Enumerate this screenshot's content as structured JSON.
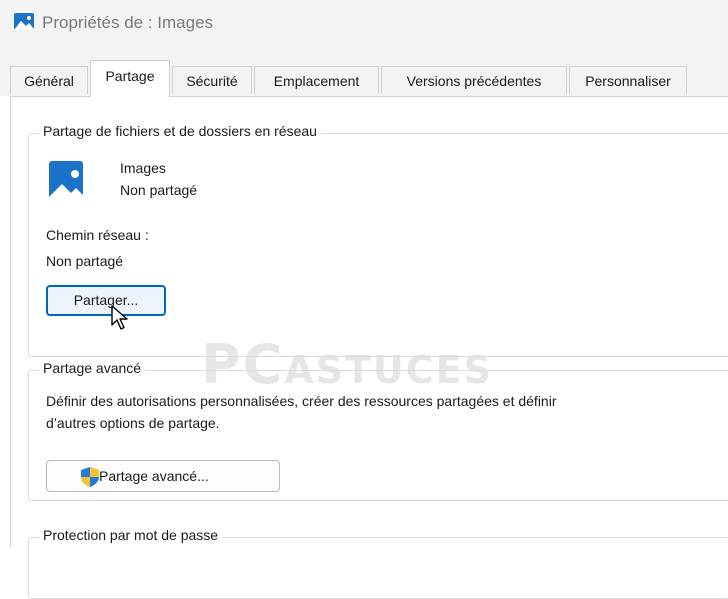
{
  "window": {
    "title": "Propriétés de : Images",
    "icon": "folder-images-icon"
  },
  "tabs": [
    {
      "label": "Général",
      "active": false
    },
    {
      "label": "Partage",
      "active": true
    },
    {
      "label": "Sécurité",
      "active": false
    },
    {
      "label": "Emplacement",
      "active": false
    },
    {
      "label": "Versions précédentes",
      "active": false
    },
    {
      "label": "Personnaliser",
      "active": false
    }
  ],
  "network_sharing": {
    "legend": "Partage de fichiers et de dossiers en réseau",
    "folder_name": "Images",
    "folder_status": "Non partagé",
    "path_label": "Chemin réseau :",
    "path_value": "Non partagé",
    "share_button": "Partager..."
  },
  "advanced_sharing": {
    "legend": "Partage avancé",
    "description_line1": "Définir des autorisations personnalisées, créer des ressources partagées et définir",
    "description_line2": "d’autres options de partage.",
    "button": "Partage avancé..."
  },
  "password_protection": {
    "legend": "Protection par mot de passe"
  },
  "watermark": {
    "big": "PC",
    "small": "ASTUCES"
  },
  "colors": {
    "accent": "#0067c0",
    "folder_icon": "#1a73c8",
    "shield_blue": "#2a79d8",
    "shield_yellow": "#f4c430"
  }
}
